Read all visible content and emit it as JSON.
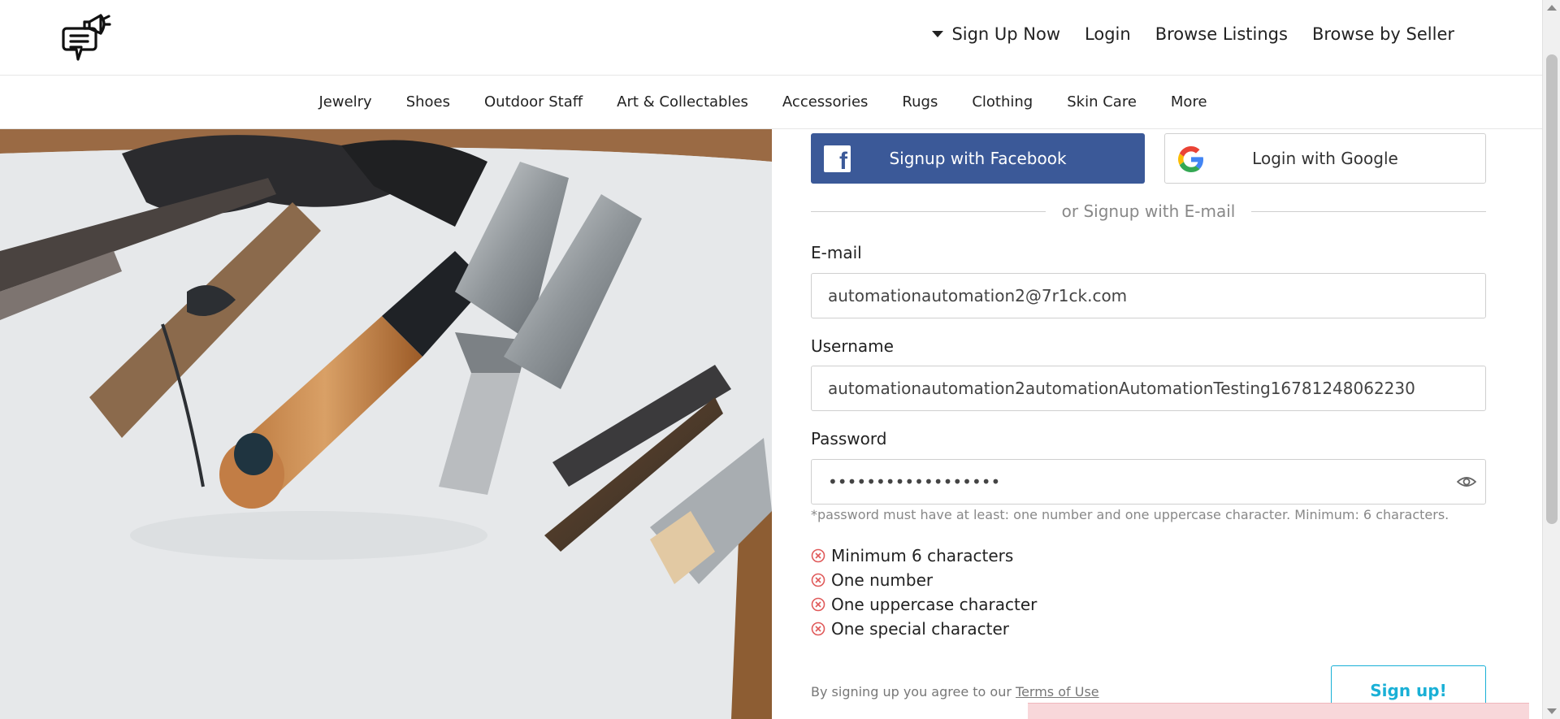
{
  "header": {
    "logo_icon": "megaphone-chat-icon",
    "nav": [
      {
        "label": "Sign Up Now",
        "has_caret": true
      },
      {
        "label": "Login"
      },
      {
        "label": "Browse Listings"
      },
      {
        "label": "Browse by Seller"
      }
    ]
  },
  "categories": [
    "Jewelry",
    "Shoes",
    "Outdoor Staff",
    "Art & Collectables",
    "Accessories",
    "Rugs",
    "Clothing",
    "Skin Care",
    "More"
  ],
  "social": {
    "facebook_label": "Signup with Facebook",
    "google_label": "Login with Google",
    "facebook_color": "#3b5998"
  },
  "divider_text": "or Signup with E-mail",
  "form": {
    "email": {
      "label": "E-mail",
      "value": "automationautomation2@7r1ck.com"
    },
    "username": {
      "label": "Username",
      "value": "automationautomation2automationAutomationTesting16781248062230"
    },
    "password": {
      "label": "Password",
      "value": "••••••••••••••••••"
    },
    "password_hint": "*password must have at least: one number and one uppercase character. Minimum: 6 characters.",
    "rules": [
      {
        "text": "Minimum 6 characters",
        "status": "failed"
      },
      {
        "text": "One number",
        "status": "failed"
      },
      {
        "text": "One uppercase character",
        "status": "failed"
      },
      {
        "text": "One special character",
        "status": "failed"
      }
    ],
    "terms_prefix": "By signing up you agree to our",
    "terms_link": "Terms of Use",
    "submit_label": "Sign up!",
    "accent_color": "#1ab0d6",
    "error_color": "#e05a5a"
  }
}
